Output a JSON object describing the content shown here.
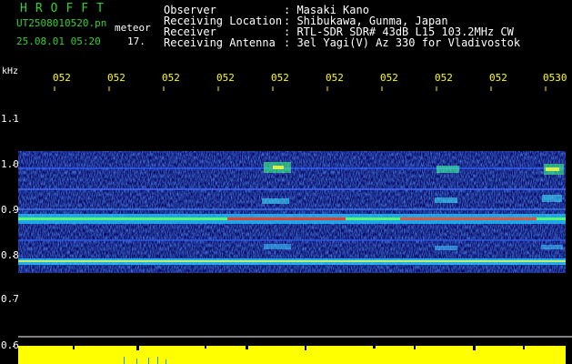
{
  "header": {
    "title": "HROFFT",
    "filename": "UT2508010520.pn",
    "type": "meteor",
    "date_time": "25.08.01 05:20",
    "seconds": "17."
  },
  "info": [
    {
      "label": "Observer",
      "value": ": Masaki Kano"
    },
    {
      "label": "Receiving Location",
      "value": ": Shibukawa, Gunma, Japan"
    },
    {
      "label": "Receiver",
      "value": ": RTL-SDR SDR# 43dB L15 103.2MHz CW"
    },
    {
      "label": "Receiving Antenna",
      "value": ": 3el Yagi(V) Az 330 for Vladivostok"
    }
  ],
  "axis": {
    "unit": "kHz",
    "freq_labels": [
      "1.1",
      "1.0",
      "0.9",
      "0.8",
      "0.7",
      "0.6"
    ],
    "time_labels": [
      "052",
      "052",
      "052",
      "052",
      "052",
      "052",
      "052",
      "052",
      "052",
      "0530"
    ]
  },
  "colors": {
    "text_green": "#33d033",
    "text_white": "#ffffff",
    "text_yellow": "#ffff00",
    "spectrum_bg": "#000080",
    "signal_red": "#ff2020",
    "baseline_yellow": "#ffff00"
  }
}
